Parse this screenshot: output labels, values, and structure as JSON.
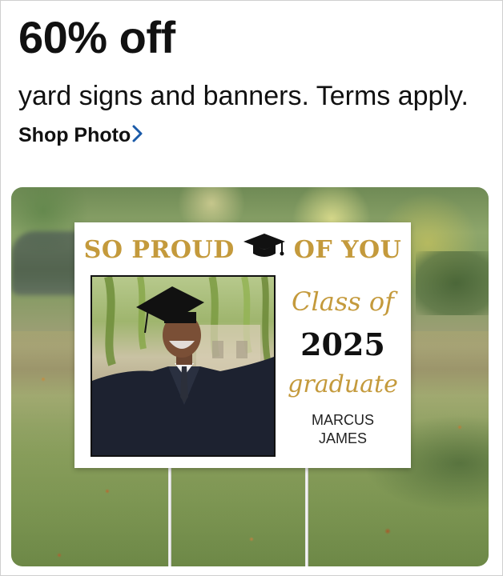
{
  "promo": {
    "headline": "60% off",
    "subline": "yard signs and banners. Terms apply.",
    "link_label": "Shop Photo",
    "link_chevron_icon": "chevron-right-icon",
    "link_chevron_color": "#1a5aa8"
  },
  "sign": {
    "title_left": "SO PROUD",
    "title_right": "OF YOU",
    "title_icon": "graduation-cap-icon",
    "class_of": "Class of",
    "year": "2025",
    "graduate": "graduate",
    "name_first": "MARCUS",
    "name_last": "JAMES",
    "accent_color": "#c49a3c"
  }
}
